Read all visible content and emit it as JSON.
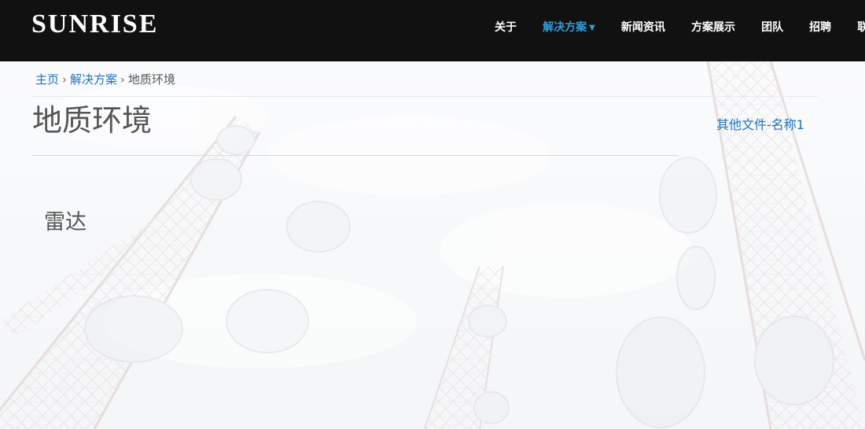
{
  "header": {
    "logo": "SUNRISE",
    "nav": [
      {
        "label": "关于"
      },
      {
        "label": "解决方案",
        "active": true,
        "dropdown": true
      },
      {
        "label": "新闻资讯"
      },
      {
        "label": "方案展示"
      },
      {
        "label": "团队"
      },
      {
        "label": "招聘"
      },
      {
        "label": "联系"
      }
    ]
  },
  "breadcrumb": {
    "home": "主页",
    "separator": "›",
    "parent": "解决方案",
    "current": "地质环境"
  },
  "page": {
    "title": "地质环境",
    "side_link": "其他文件-名称1",
    "section_title": "雷达"
  },
  "colors": {
    "header_bg": "#111111",
    "nav_active": "#2f9fd8",
    "link": "#1a73c6"
  }
}
